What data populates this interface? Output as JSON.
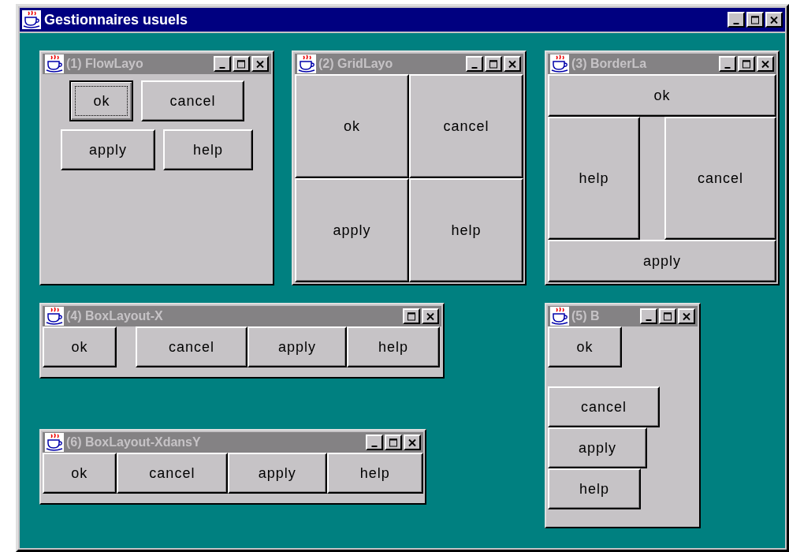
{
  "window": {
    "title": "Gestionnaires usuels",
    "active": true,
    "controls": [
      {
        "kind": "minimize"
      },
      {
        "kind": "maximize"
      },
      {
        "kind": "close"
      }
    ]
  },
  "frames": [
    {
      "title": "(1) FlowLayo",
      "active": false,
      "kind": "flow",
      "controls": [
        {
          "kind": "minimize"
        },
        {
          "kind": "maximize"
        },
        {
          "kind": "close"
        }
      ],
      "buttons": [
        {
          "label": "ok",
          "focused": true
        },
        {
          "label": "cancel",
          "focused": false
        },
        {
          "label": "apply",
          "focused": false
        },
        {
          "label": "help",
          "focused": false
        }
      ]
    },
    {
      "title": "(2) GridLayo",
      "active": false,
      "kind": "grid",
      "controls": [
        {
          "kind": "minimize"
        },
        {
          "kind": "maximize"
        },
        {
          "kind": "close"
        }
      ],
      "buttons": [
        {
          "label": "ok",
          "focused": false
        },
        {
          "label": "cancel",
          "focused": false
        },
        {
          "label": "apply",
          "focused": false
        },
        {
          "label": "help",
          "focused": false
        }
      ]
    },
    {
      "title": "(3) BorderLa",
      "active": false,
      "kind": "border",
      "controls": [
        {
          "kind": "minimize"
        },
        {
          "kind": "maximize"
        },
        {
          "kind": "close"
        }
      ],
      "buttons": [
        {
          "label": "ok",
          "focused": false
        },
        {
          "label": "help",
          "focused": false
        },
        {
          "label": "cancel",
          "focused": false
        },
        {
          "label": "apply",
          "focused": false
        }
      ]
    },
    {
      "title": "(4) BoxLayout-X",
      "active": false,
      "kind": "box-x",
      "controls": [
        {
          "kind": "maximize"
        },
        {
          "kind": "close"
        }
      ],
      "buttons": [
        {
          "label": "ok",
          "focused": false
        },
        {
          "label": "cancel",
          "focused": false
        },
        {
          "label": "apply",
          "focused": false
        },
        {
          "label": "help",
          "focused": false
        }
      ]
    },
    {
      "title": "(5) B",
      "active": false,
      "kind": "box-y",
      "controls": [
        {
          "kind": "minimize"
        },
        {
          "kind": "maximize"
        },
        {
          "kind": "close"
        }
      ],
      "buttons": [
        {
          "label": "ok",
          "focused": false
        },
        {
          "label": "cancel",
          "focused": false
        },
        {
          "label": "apply",
          "focused": false
        },
        {
          "label": "help",
          "focused": false
        }
      ]
    },
    {
      "title": "(6) BoxLayout-XdansY",
      "active": false,
      "kind": "box-x-in-y",
      "controls": [
        {
          "kind": "minimize"
        },
        {
          "kind": "maximize"
        },
        {
          "kind": "close"
        }
      ],
      "buttons": [
        {
          "label": "ok",
          "focused": false
        },
        {
          "label": "cancel",
          "focused": false
        },
        {
          "label": "apply",
          "focused": false
        },
        {
          "label": "help",
          "focused": false
        }
      ]
    }
  ]
}
